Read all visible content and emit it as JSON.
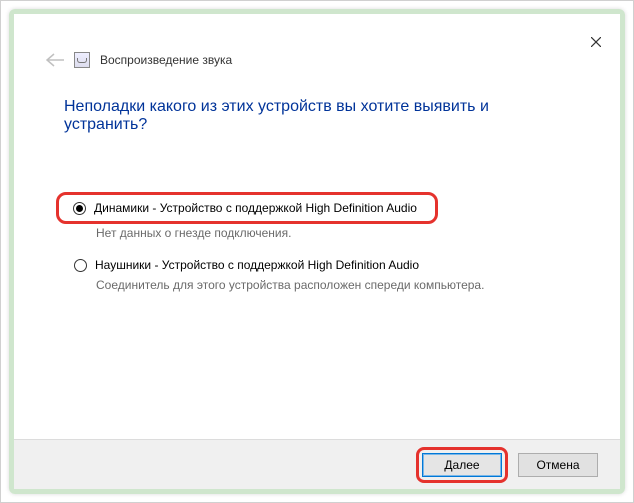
{
  "header": {
    "title": "Воспроизведение звука"
  },
  "heading": "Неполадки какого из этих устройств вы хотите выявить и устранить?",
  "options": [
    {
      "label": "Динамики - Устройство с поддержкой High Definition Audio",
      "sub": "Нет данных о гнезде подключения.",
      "checked": true,
      "highlighted": true
    },
    {
      "label": "Наушники - Устройство с поддержкой High Definition Audio",
      "sub": "Соединитель для этого устройства расположен спереди компьютера.",
      "checked": false,
      "highlighted": false
    }
  ],
  "buttons": {
    "next": "Далее",
    "cancel": "Отмена"
  }
}
